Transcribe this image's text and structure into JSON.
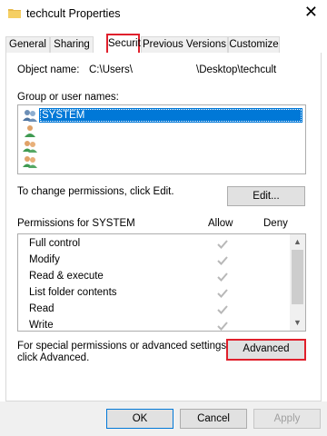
{
  "window": {
    "title": "techcult Properties",
    "close_glyph": "✕"
  },
  "tabs": [
    {
      "label": "General",
      "active": false
    },
    {
      "label": "Sharing",
      "active": false
    },
    {
      "label": "Security",
      "active": true
    },
    {
      "label": "Previous Versions",
      "active": false
    },
    {
      "label": "Customize",
      "active": false
    }
  ],
  "object": {
    "label": "Object name:",
    "path_start": "C:\\Users\\",
    "path_end": "\\Desktop\\techcult"
  },
  "groups": {
    "label": "Group or user names:",
    "items": [
      {
        "name": "SYSTEM",
        "selected": true
      },
      {
        "name": "",
        "selected": false
      },
      {
        "name": "",
        "selected": false
      },
      {
        "name": "",
        "selected": false
      }
    ]
  },
  "change_perms": {
    "text": "To change permissions, click Edit.",
    "edit_button": "Edit..."
  },
  "permissions": {
    "header": "Permissions for SYSTEM",
    "allow_header": "Allow",
    "deny_header": "Deny",
    "rows": [
      {
        "name": "Full control",
        "allow": true,
        "deny": false
      },
      {
        "name": "Modify",
        "allow": true,
        "deny": false
      },
      {
        "name": "Read & execute",
        "allow": true,
        "deny": false
      },
      {
        "name": "List folder contents",
        "allow": true,
        "deny": false
      },
      {
        "name": "Read",
        "allow": true,
        "deny": false
      },
      {
        "name": "Write",
        "allow": true,
        "deny": false
      }
    ]
  },
  "advanced": {
    "line1": "For special permissions or advanced settings,",
    "line2": "click Advanced.",
    "button": "Advanced"
  },
  "footer": {
    "ok": "OK",
    "cancel": "Cancel",
    "apply": "Apply"
  },
  "colors": {
    "highlight_red": "#e0202c",
    "selection_blue": "#0078d7",
    "check_gray": "#b8b8b8"
  },
  "icons": {
    "title": "folder-icon",
    "users": "user-group-icon",
    "check": "checkmark-icon"
  }
}
